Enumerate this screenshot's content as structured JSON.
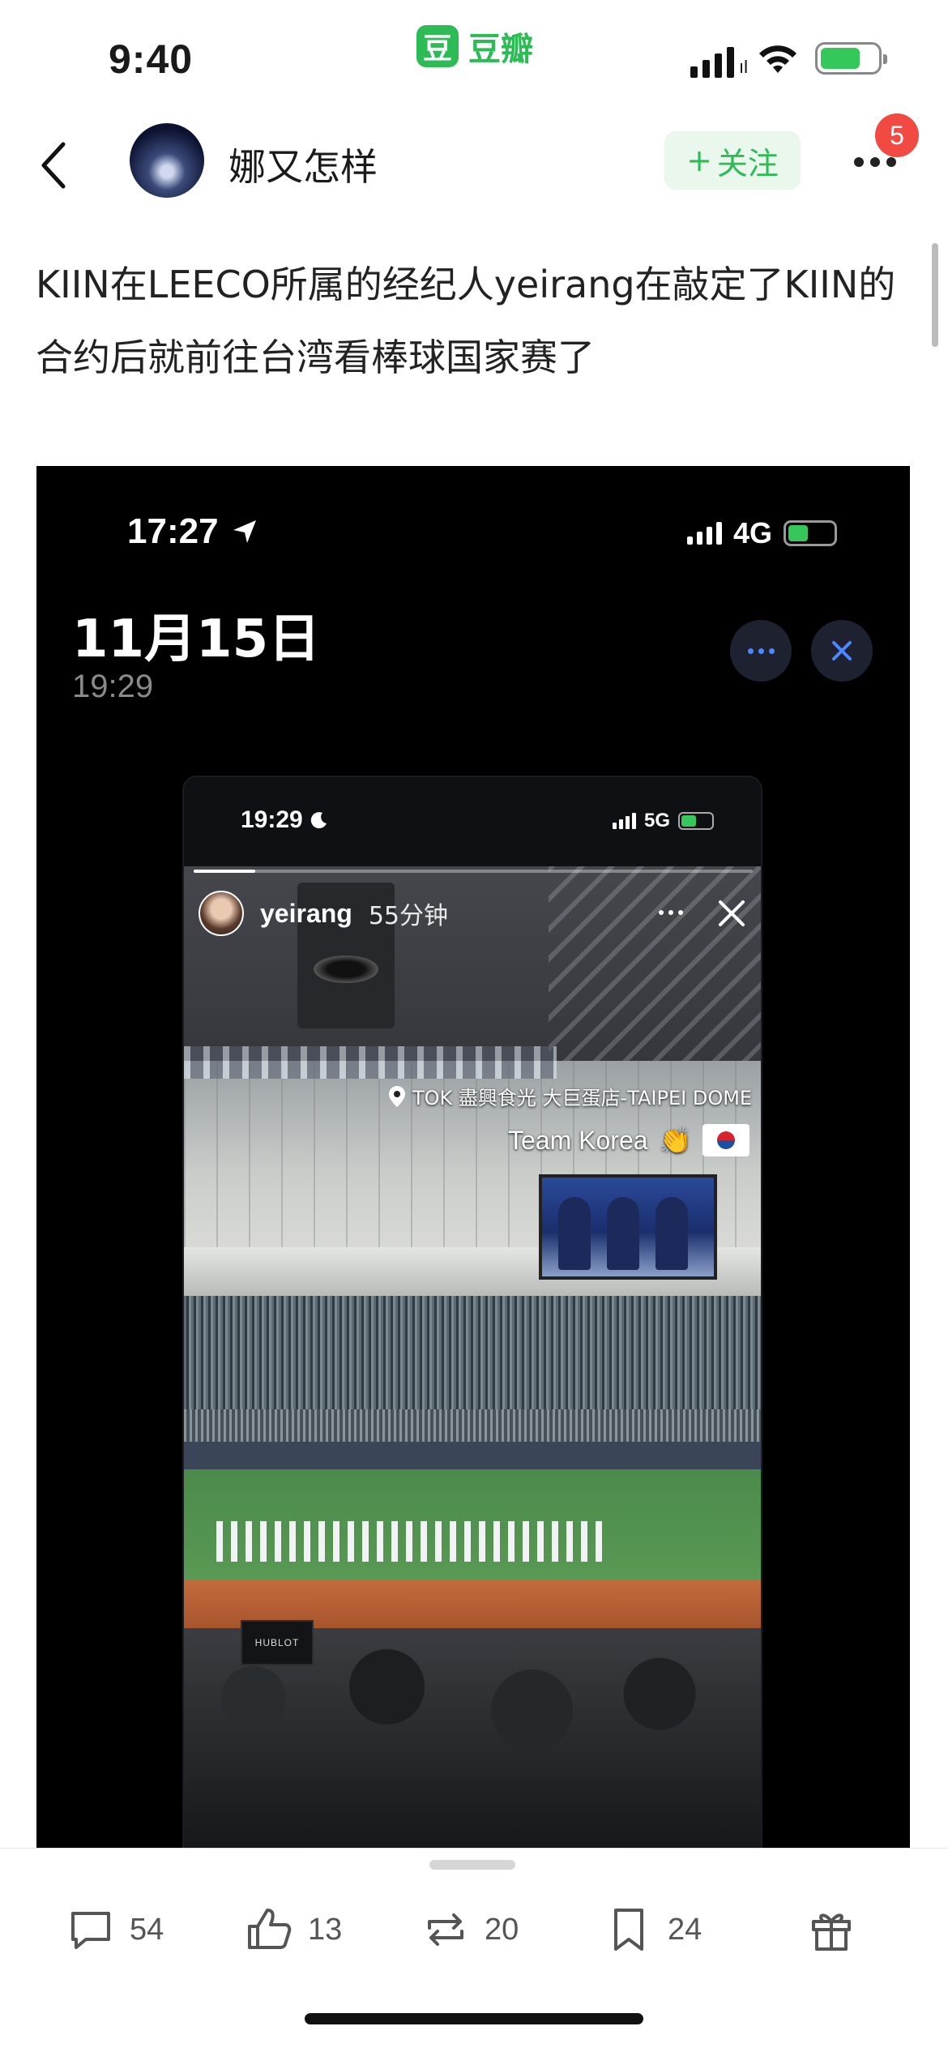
{
  "status_bar": {
    "time": "9:40",
    "app_logo_char": "豆",
    "app_name": "豆瓣",
    "battery_color": "#35c759"
  },
  "header": {
    "back_icon": "chevron-left-icon",
    "author_name": "娜又怎样",
    "follow_label": "关注",
    "follow_prefix": "+",
    "more_icon": "more-dots-icon",
    "notification_count": "5",
    "accent_color": "#2dbb55"
  },
  "post": {
    "text": "KIIN在LEECO所属的经纪人yeirang在敲定了KIIN的合约后就前往台湾看棒球国家赛了"
  },
  "image": {
    "phone_time": "17:27",
    "network": "4G",
    "date": "11月15日",
    "time": "19:29",
    "story": {
      "status_time": "19:29",
      "network": "5G",
      "username": "yeirang",
      "ago": "55分钟",
      "location": "TOK 盡興食光 大巨蛋店-TAIPEI DOME",
      "caption": "Team Korea",
      "sponsor": "HUBLOT"
    }
  },
  "actions": {
    "comments": "54",
    "likes": "13",
    "reposts": "20",
    "bookmarks": "24"
  }
}
